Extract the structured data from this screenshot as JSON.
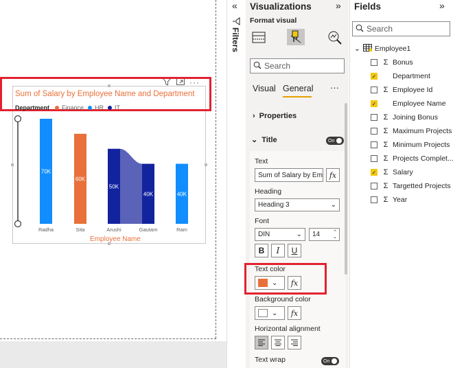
{
  "visual": {
    "title": "Sum of Salary by Employee Name and Department",
    "legend_title": "Department",
    "legend_items": [
      {
        "label": "Finance",
        "color": "#e8703a"
      },
      {
        "label": "HR",
        "color": "#118dff"
      },
      {
        "label": "IT",
        "color": "#12239e"
      }
    ],
    "toolbar_icons": [
      "filter-icon",
      "focus-mode-icon",
      "more-options-icon"
    ]
  },
  "chart_data": {
    "type": "bar",
    "categories": [
      "Radha",
      "Sita",
      "Arushi",
      "Gautam",
      "Ram"
    ],
    "series": [
      {
        "name": "HR",
        "values": [
          70,
          null,
          null,
          null,
          40
        ],
        "color": "#118dff"
      },
      {
        "name": "Finance",
        "values": [
          null,
          60,
          null,
          null,
          null
        ],
        "color": "#e8703a"
      },
      {
        "name": "IT",
        "values": [
          null,
          null,
          50,
          40,
          null
        ],
        "color": "#12239e"
      }
    ],
    "data_labels": [
      "70K",
      "60K",
      "50K",
      "40K",
      "40K"
    ],
    "xlabel": "Employee Name",
    "ylabel": "",
    "ylim": [
      0,
      70
    ]
  },
  "filters": {
    "label": "Filters"
  },
  "visualizations": {
    "title": "Visualizations",
    "format_visual_label": "Format visual",
    "search_placeholder": "Search",
    "tabs": [
      "Visual",
      "General"
    ],
    "active_tab": "General",
    "sections": {
      "properties": "Properties",
      "title": "Title",
      "title_toggle": "On"
    },
    "title_card": {
      "text_label": "Text",
      "text_value": "Sum of Salary by Employee Name and Department",
      "heading_label": "Heading",
      "heading_value": "Heading 3",
      "font_label": "Font",
      "font_value": "DIN",
      "font_size": "14",
      "bold": "B",
      "italic": "I",
      "underline": "U",
      "text_color_label": "Text color",
      "text_color": "#e8703a",
      "background_color_label": "Background color",
      "horizontal_alignment_label": "Horizontal alignment",
      "text_wrap_label": "Text wrap",
      "text_wrap_toggle": "On",
      "fx": "fx"
    }
  },
  "fields": {
    "title": "Fields",
    "search_placeholder": "Search",
    "table_name": "Employee1",
    "items": [
      {
        "label": "Bonus",
        "checked": false,
        "sigma": true
      },
      {
        "label": "Department",
        "checked": true,
        "sigma": false
      },
      {
        "label": "Employee Id",
        "checked": false,
        "sigma": true
      },
      {
        "label": "Employee Name",
        "checked": true,
        "sigma": false
      },
      {
        "label": "Joining Bonus",
        "checked": false,
        "sigma": true
      },
      {
        "label": "Maximum Projects",
        "checked": false,
        "sigma": true
      },
      {
        "label": "Minimum Projects",
        "checked": false,
        "sigma": true
      },
      {
        "label": "Projects Complet...",
        "checked": false,
        "sigma": true
      },
      {
        "label": "Salary",
        "checked": true,
        "sigma": true
      },
      {
        "label": "Targetted Projects",
        "checked": false,
        "sigma": true
      },
      {
        "label": "Year",
        "checked": false,
        "sigma": true
      }
    ]
  }
}
